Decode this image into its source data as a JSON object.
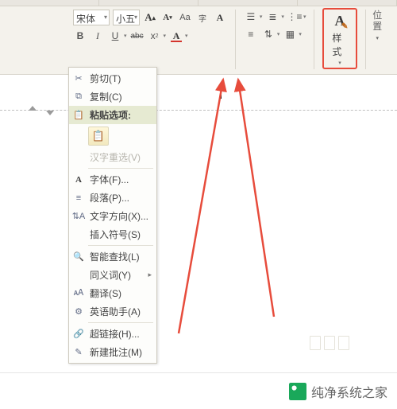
{
  "ribbon": {
    "font_name": "宋体",
    "font_size": "小五",
    "grow_font": "A",
    "shrink_font": "A",
    "phonetic": "abc",
    "change_case": "Aa",
    "bold": "B",
    "italic": "I",
    "underline": "U",
    "strike": "abc",
    "font_color_icon": "A",
    "style_icon": "A",
    "style_label": "样式"
  },
  "right_tabs": {
    "line1": "位置"
  },
  "context": {
    "cut": "剪切(T)",
    "copy": "复制(C)",
    "paste_options": "粘贴选项:",
    "hanzi": "汉字重选(V)",
    "font": "字体(F)...",
    "paragraph": "段落(P)...",
    "text_direction": "文字方向(X)...",
    "insert_symbol": "插入符号(S)",
    "smart_lookup": "智能查找(L)",
    "synonyms": "同义词(Y)",
    "translate": "翻译(S)",
    "english_assistant": "英语助手(A)",
    "hyperlink": "超链接(H)...",
    "new_comment": "新建批注(M)"
  },
  "footer": {
    "brand": "纯净系统之家"
  }
}
